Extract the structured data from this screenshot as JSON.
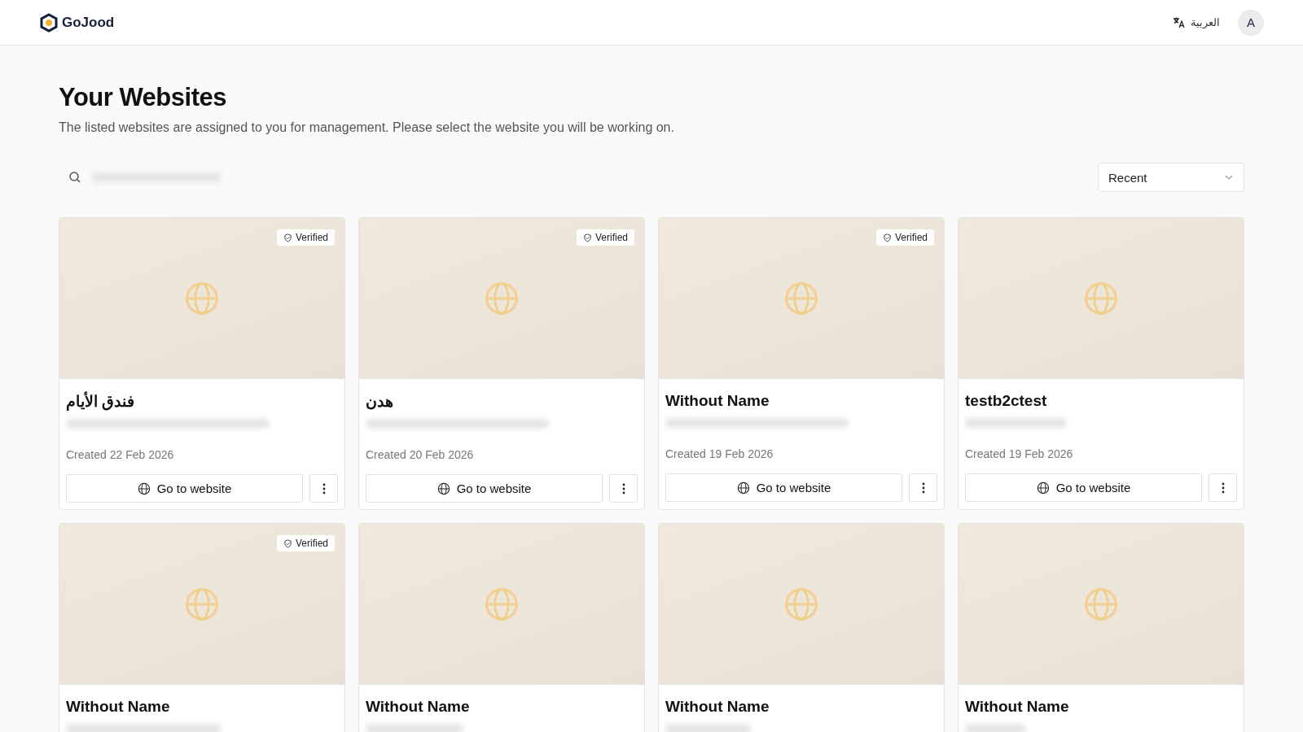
{
  "header": {
    "brand": "GoJood",
    "language": "العربية",
    "avatar": "A"
  },
  "page": {
    "title": "Your Websites",
    "subtitle": "The listed websites are assigned to you for management. Please select the website you will be working on."
  },
  "sort": {
    "value": "Recent"
  },
  "websites": [
    {
      "name": "فندق الأيام",
      "badge": "Verified",
      "created": "Created 22 Feb 2026",
      "action": "Go to website"
    },
    {
      "name": "هدن",
      "badge": "Verified",
      "created": "Created 20 Feb 2026",
      "action": "Go to website"
    },
    {
      "name": "Without Name",
      "badge": "Verified",
      "created": "Created 19 Feb 2026",
      "action": "Go to website"
    },
    {
      "name": "testb2ctest",
      "created": "Created 19 Feb 2026",
      "action": "Go to website"
    },
    {
      "name": "Without Name",
      "badge": "Verified"
    },
    {
      "name": "Without Name"
    },
    {
      "name": "Without Name"
    },
    {
      "name": "Without Name"
    }
  ]
}
